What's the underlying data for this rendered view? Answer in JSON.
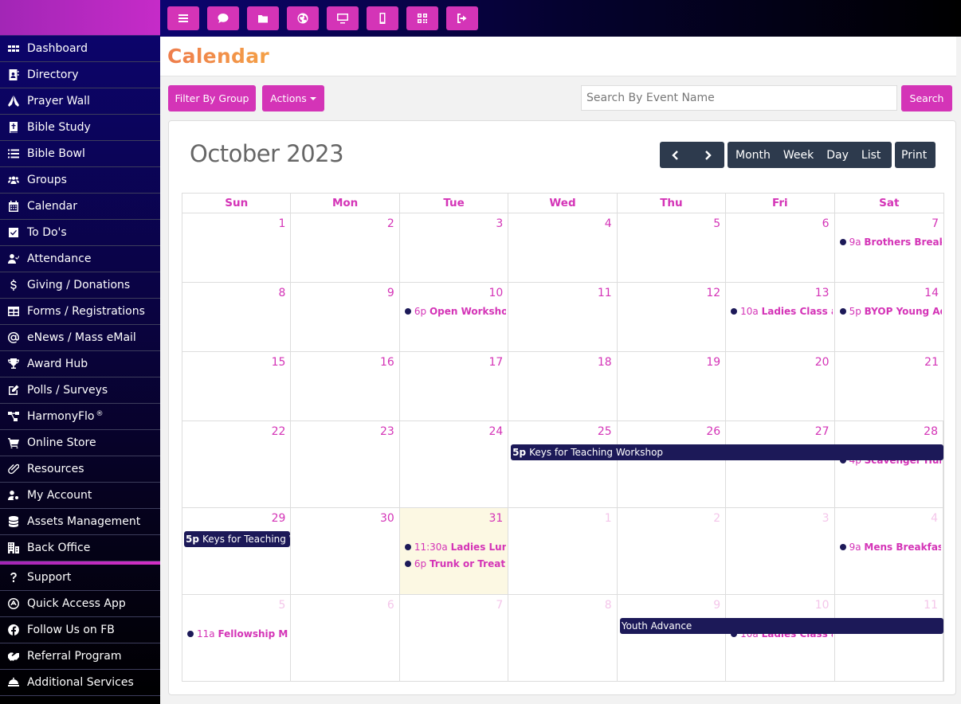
{
  "topbar": {
    "buttons": [
      {
        "name": "menu",
        "icon": "bars-icon"
      },
      {
        "name": "chat",
        "icon": "comment-icon"
      },
      {
        "name": "files",
        "icon": "folder-icon"
      },
      {
        "name": "web",
        "icon": "globe-icon"
      },
      {
        "name": "desktop",
        "icon": "desktop-icon"
      },
      {
        "name": "mobile",
        "icon": "mobile-icon"
      },
      {
        "name": "qr",
        "icon": "qrcode-icon"
      },
      {
        "name": "logout",
        "icon": "sign-out-icon"
      }
    ]
  },
  "sidebar": {
    "items": [
      {
        "label": "Dashboard",
        "icon": "grid-icon"
      },
      {
        "label": "Directory",
        "icon": "address-book-icon"
      },
      {
        "label": "Prayer Wall",
        "icon": "praying-hands-icon"
      },
      {
        "label": "Bible Study",
        "icon": "bible-icon"
      },
      {
        "label": "Bible Bowl",
        "icon": "list-icon"
      },
      {
        "label": "Groups",
        "icon": "users-icon"
      },
      {
        "label": "Calendar",
        "icon": "calendar-icon"
      },
      {
        "label": "To Do's",
        "icon": "check-square-icon"
      },
      {
        "label": "Attendance",
        "icon": "user-check-icon"
      },
      {
        "label": "Giving / Donations",
        "icon": "dollar-icon"
      },
      {
        "label": "Forms / Registrations",
        "icon": "table-icon"
      },
      {
        "label": "eNews / Mass eMail",
        "icon": "at-icon"
      },
      {
        "label": "Award Hub",
        "icon": "trophy-icon"
      },
      {
        "label": "Polls / Surveys",
        "icon": "edit-icon"
      },
      {
        "label": "HarmonyFlo",
        "sup": "®",
        "icon": "sitemap-icon"
      },
      {
        "label": "Online Store",
        "icon": "cart-icon"
      },
      {
        "label": "Resources",
        "icon": "paperclip-icon"
      },
      {
        "label": "My Account",
        "icon": "user-cog-icon"
      },
      {
        "label": "Assets Management",
        "icon": "database-icon"
      },
      {
        "label": "Back Office",
        "icon": "building-icon"
      }
    ],
    "secondary": [
      {
        "label": "Support",
        "icon": "question-icon"
      },
      {
        "label": "Quick Access App",
        "icon": "app-store-icon"
      },
      {
        "label": "Follow Us on FB",
        "icon": "facebook-icon"
      },
      {
        "label": "Referral Program",
        "icon": "handshake-icon"
      },
      {
        "label": "Additional Services",
        "icon": "concierge-bell-icon"
      }
    ]
  },
  "header": {
    "title": "Calendar"
  },
  "toolbar": {
    "filter_label": "Filter By Group",
    "actions_label": "Actions",
    "search_placeholder": "Search By Event Name",
    "search_value": "",
    "search_label": "Search"
  },
  "calendar": {
    "title": "October 2023",
    "prev_label": "prev",
    "next_label": "next",
    "views": [
      "Month",
      "Week",
      "Day",
      "List"
    ],
    "print_label": "Print",
    "days_of_week": [
      "Sun",
      "Mon",
      "Tue",
      "Wed",
      "Thu",
      "Fri",
      "Sat"
    ],
    "weeks": [
      {
        "days": [
          {
            "n": "1"
          },
          {
            "n": "2"
          },
          {
            "n": "3"
          },
          {
            "n": "4"
          },
          {
            "n": "5"
          },
          {
            "n": "6"
          },
          {
            "n": "7",
            "events": [
              {
                "time": "9a",
                "title": "Brothers Breakfast"
              }
            ]
          }
        ]
      },
      {
        "days": [
          {
            "n": "8"
          },
          {
            "n": "9"
          },
          {
            "n": "10",
            "events": [
              {
                "time": "6p",
                "title": "Open Workshop"
              }
            ]
          },
          {
            "n": "11"
          },
          {
            "n": "12"
          },
          {
            "n": "13",
            "events": [
              {
                "time": "10a",
                "title": "Ladies Class at the"
              }
            ]
          },
          {
            "n": "14",
            "events": [
              {
                "time": "5p",
                "title": "BYOP Young Adults"
              }
            ]
          }
        ]
      },
      {
        "days": [
          {
            "n": "15"
          },
          {
            "n": "16"
          },
          {
            "n": "17"
          },
          {
            "n": "18"
          },
          {
            "n": "19"
          },
          {
            "n": "20"
          },
          {
            "n": "21"
          }
        ]
      },
      {
        "days": [
          {
            "n": "22"
          },
          {
            "n": "23"
          },
          {
            "n": "24"
          },
          {
            "n": "25"
          },
          {
            "n": "26"
          },
          {
            "n": "27"
          },
          {
            "n": "28",
            "events": [
              {
                "time": "4p",
                "title": "Scavenger Hunt"
              }
            ]
          }
        ],
        "bars": [
          {
            "time": "5p",
            "title": "Keys for Teaching Workshop",
            "start": 3,
            "span": 4
          }
        ]
      },
      {
        "days": [
          {
            "n": "29"
          },
          {
            "n": "30"
          },
          {
            "n": "31",
            "today": true,
            "events": [
              {
                "time": "11:30a",
                "title": "Ladies Luncheon"
              },
              {
                "time": "6p",
                "title": "Trunk or Treat"
              }
            ]
          },
          {
            "n": "1",
            "other": true
          },
          {
            "n": "2",
            "other": true
          },
          {
            "n": "3",
            "other": true
          },
          {
            "n": "4",
            "other": true,
            "events": [
              {
                "time": "9a",
                "title": "Mens Breakfast"
              }
            ]
          }
        ],
        "bars": [
          {
            "time": "5p",
            "title": "Keys for Teaching Workshop",
            "start": 0,
            "span": 1
          }
        ]
      },
      {
        "days": [
          {
            "n": "5",
            "other": true,
            "events": [
              {
                "time": "11a",
                "title": "Fellowship Meeting"
              }
            ]
          },
          {
            "n": "6",
            "other": true
          },
          {
            "n": "7",
            "other": true
          },
          {
            "n": "8",
            "other": true
          },
          {
            "n": "9",
            "other": true
          },
          {
            "n": "10",
            "other": true,
            "events": [
              {
                "time": "10a",
                "title": "Ladies Class at the"
              }
            ]
          },
          {
            "n": "11",
            "other": true
          }
        ],
        "bars": [
          {
            "time": "",
            "title": "Youth Advance",
            "start": 4,
            "span": 3
          }
        ]
      }
    ]
  },
  "colors": {
    "accent": "#d434b7",
    "title_orange": "#f0894a",
    "event_navy": "#1c1958",
    "toolbar_dark": "#2d3a4d",
    "today_bg": "#fcf8e3"
  }
}
